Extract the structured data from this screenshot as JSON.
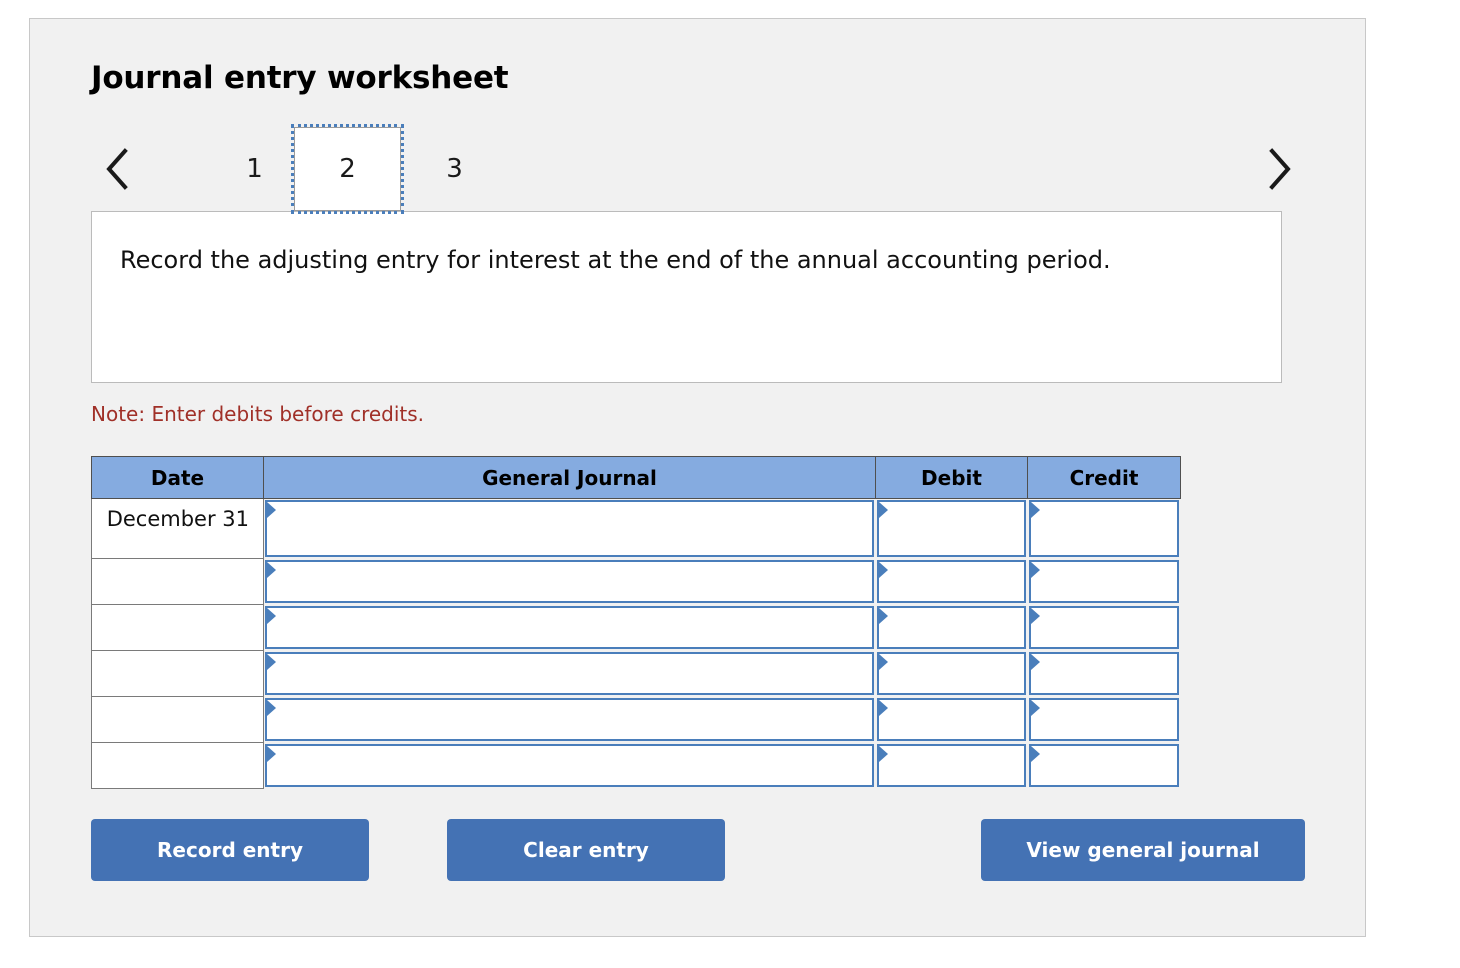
{
  "worksheet": {
    "title": "Journal entry worksheet",
    "description": "Record the adjusting entry for interest at the end of the annual accounting period.",
    "note": "Note: Enter debits before credits."
  },
  "pager": {
    "prev_label": "‹",
    "next_label": "›",
    "prev_icon": "chevron-left-icon",
    "next_icon": "chevron-right-icon",
    "tabs": [
      {
        "label": "1",
        "active": false
      },
      {
        "label": "2",
        "active": true
      },
      {
        "label": "3",
        "active": false
      }
    ],
    "active_tab": "2"
  },
  "table": {
    "headers": {
      "date": "Date",
      "general_journal": "General Journal",
      "debit": "Debit",
      "credit": "Credit"
    },
    "rows": [
      {
        "date": "December 31",
        "general_journal": "",
        "debit": "",
        "credit": ""
      },
      {
        "date": "",
        "general_journal": "",
        "debit": "",
        "credit": ""
      },
      {
        "date": "",
        "general_journal": "",
        "debit": "",
        "credit": ""
      },
      {
        "date": "",
        "general_journal": "",
        "debit": "",
        "credit": ""
      },
      {
        "date": "",
        "general_journal": "",
        "debit": "",
        "credit": ""
      },
      {
        "date": "",
        "general_journal": "",
        "debit": "",
        "credit": ""
      }
    ]
  },
  "buttons": {
    "record_entry": "Record entry",
    "clear_entry": "Clear entry",
    "view_general_journal": "View general journal"
  },
  "colors": {
    "panel_background": "#f1f1f1",
    "header_blue": "#85abe0",
    "button_blue": "#4472b4",
    "field_border_blue": "#4a7ebb",
    "note_red": "#a03028"
  }
}
